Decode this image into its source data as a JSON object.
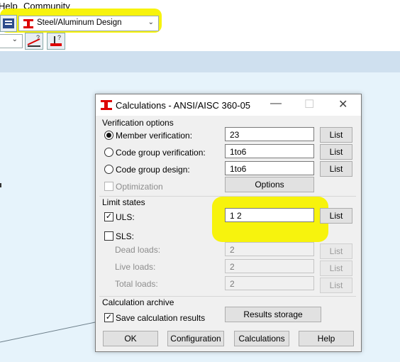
{
  "menubar": {
    "items": [
      "Help",
      "Community"
    ]
  },
  "toolbar": {
    "module_select": {
      "value": "Steel/Aluminum Design"
    }
  },
  "dialog": {
    "title": "Calculations - ANSI/AISC 360-05",
    "verification": {
      "heading": "Verification options",
      "member": {
        "label": "Member verification:",
        "value": "23",
        "list": "List"
      },
      "code_group_verification": {
        "label": "Code group verification:",
        "value": "1to6",
        "list": "List"
      },
      "code_group_design": {
        "label": "Code group design:",
        "value": "1to6",
        "list": "List"
      },
      "optimization": {
        "label": "Optimization"
      },
      "options_button": "Options"
    },
    "limit_states": {
      "heading": "Limit states",
      "uls": {
        "label": "ULS:",
        "value": "1 2",
        "list": "List"
      },
      "sls": {
        "label": "SLS:"
      },
      "dead": {
        "label": "Dead loads:",
        "value": "2",
        "list": "List"
      },
      "live": {
        "label": "Live loads:",
        "value": "2",
        "list": "List"
      },
      "total": {
        "label": "Total loads:",
        "value": "2",
        "list": "List"
      }
    },
    "archive": {
      "heading": "Calculation archive",
      "save": {
        "label": "Save calculation results"
      },
      "results_storage": "Results storage"
    },
    "footer": {
      "ok": "OK",
      "configuration": "Configuration",
      "calculations": "Calculations",
      "help": "Help"
    }
  },
  "colors": {
    "highlight": "#f7f200",
    "workspace": "#e6f3fb",
    "band": "#cfe0ef"
  }
}
